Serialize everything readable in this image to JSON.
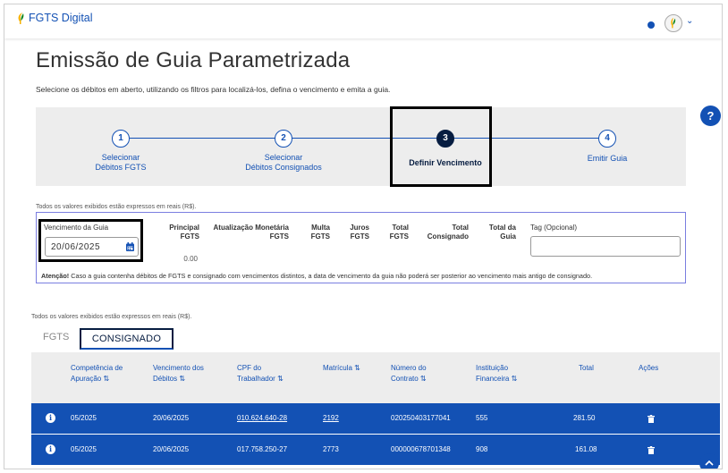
{
  "header": {
    "logo_text": "FGTS Digital",
    "icons": [
      "leaf-logo-icon",
      "notification-dot-icon",
      "user-avatar-icon",
      "chevron-down-icon"
    ],
    "chevron": "⌄"
  },
  "help": {
    "label": "?"
  },
  "page": {
    "title": "Emissão de Guia Parametrizada",
    "subtitle": "Selecione os débitos em aberto, utilizando os filtros para localizá-los, defina o vencimento e emita a guia."
  },
  "stepper": {
    "steps": [
      {
        "number": "1",
        "line1": "Selecionar",
        "line2": "Débitos FGTS"
      },
      {
        "number": "2",
        "line1": "Selecionar",
        "line2": "Débitos Consignados"
      },
      {
        "number": "3",
        "line1": "Definir Vencimento",
        "line2": ""
      },
      {
        "number": "4",
        "line1": "Emitir Guia",
        "line2": ""
      }
    ],
    "active_step": 3
  },
  "filters": {
    "note": "Todos os valores exibidos estão expressos em reais (R$).",
    "vencimento_label": "Vencimento da Guia",
    "vencimento_value": "20/06/2025",
    "columns": {
      "principal": [
        "Principal",
        "FGTS"
      ],
      "atualizacao": [
        "Atualização Monetária",
        "FGTS"
      ],
      "multa": [
        "Multa",
        "FGTS"
      ],
      "juros": [
        "Juros",
        "FGTS"
      ],
      "total_fgts": [
        "Total",
        "FGTS"
      ],
      "total_consig": [
        "Total",
        "Consignado"
      ],
      "total_guia": [
        "Total da",
        "Guia"
      ]
    },
    "principal_value": "0.00",
    "tag_label": "Tag (Opcional)",
    "tag_value": "",
    "attention_label": "Atenção!",
    "attention_text": " Caso a guia contenha débitos de FGTS e consignado com vencimentos distintos, a data de vencimento da guia não poderá ser posterior ao vencimento mais antigo de consignado."
  },
  "table_section": {
    "note": "Todos os valores exibidos estão expressos em reais (R$).",
    "tabs": [
      "FGTS",
      "CONSIGNADO"
    ],
    "active_tab": "CONSIGNADO",
    "headers": {
      "competencia": [
        "Competência de",
        "Apuração ⇅"
      ],
      "vencimento": [
        "Vencimento dos",
        "Débitos ⇅"
      ],
      "cpf": [
        "CPF do",
        "Trabalhador ⇅"
      ],
      "matricula": [
        "Matrícula ⇅",
        ""
      ],
      "contrato": [
        "Número do",
        "Contrato ⇅"
      ],
      "instituicao": [
        "Instituição",
        "Financeira ⇅"
      ],
      "total": [
        "Total",
        ""
      ],
      "acoes": [
        "Ações",
        ""
      ]
    },
    "rows": [
      {
        "competencia": "05/2025",
        "vencimento": "20/06/2025",
        "cpf": "010.624.640-28",
        "matricula": "2192",
        "contrato": "020250403177041",
        "instituicao": "555",
        "total": "281.50"
      },
      {
        "competencia": "05/2025",
        "vencimento": "20/06/2025",
        "cpf": "017.758.250-27",
        "matricula": "2773",
        "contrato": "000000678701348",
        "instituicao": "908",
        "total": "161.08"
      }
    ]
  },
  "colors": {
    "primary": "#1351b4",
    "dark": "#071d41",
    "stepper_bg": "#ededed"
  }
}
